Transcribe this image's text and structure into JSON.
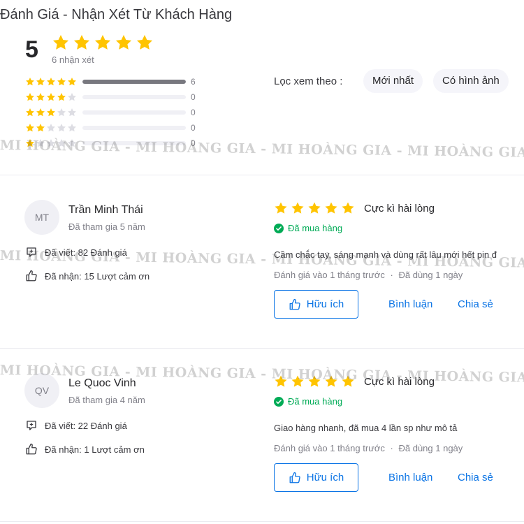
{
  "header": {
    "title": "Đánh Giá - Nhận Xét Từ Khách Hàng"
  },
  "summary": {
    "average": "5",
    "rating": 5,
    "count_label": "6 nhận xét"
  },
  "histogram": [
    {
      "stars": 5,
      "count": "6",
      "fraction": 1.0
    },
    {
      "stars": 4,
      "count": "0",
      "fraction": 0
    },
    {
      "stars": 3,
      "count": "0",
      "fraction": 0
    },
    {
      "stars": 2,
      "count": "0",
      "fraction": 0
    },
    {
      "stars": 1,
      "count": "0",
      "fraction": 0
    }
  ],
  "filter": {
    "label": "Lọc xem theo :",
    "options": [
      "Mới nhất",
      "Có hình ảnh"
    ]
  },
  "reviews": [
    {
      "initials": "MT",
      "name": "Trần Minh Thái",
      "joined": "Đã tham gia 5 năm",
      "written": "Đã viết: 82 Đánh giá",
      "thanks": "Đã nhận: 15 Lượt cảm ơn",
      "rating": 5,
      "headline": "Cực kì hài lòng",
      "verified": "Đã mua hàng",
      "content": "Cầm chắc tay, sáng mạnh và dùng rất lâu mới hết pin đ",
      "reviewed_time": "Đánh giá vào 1 tháng trước",
      "used_time": "Đã dùng 1 ngày"
    },
    {
      "initials": "QV",
      "name": "Le Quoc Vinh",
      "joined": "Đã tham gia 4 năm",
      "written": "Đã viết: 22 Đánh giá",
      "thanks": "Đã nhận: 1 Lượt cảm ơn",
      "rating": 5,
      "headline": "Cực kì hài lòng",
      "verified": "Đã mua hàng",
      "content": "Giao hàng nhanh, đã mua 4 lần sp như mô tả",
      "reviewed_time": "Đánh giá vào 1 tháng trước",
      "used_time": "Đã dùng 1 ngày"
    }
  ],
  "actions": {
    "helpful": "Hữu ích",
    "comment": "Bình luận",
    "share": "Chia sẻ"
  },
  "meta_separator": "·",
  "watermark": "MI HOÀNG GIA - MI HOÀNG GIA - MI HOÀNG GIA - MI HOÀNG GIA - MI HOÀNG GIA",
  "colors": {
    "star": "#ffc400",
    "star_empty": "#dddde3",
    "link": "#0b74e5",
    "verified": "#00ab56"
  },
  "icons": [
    "star-icon",
    "check-circle-icon",
    "comment-icon",
    "thumbs-up-icon"
  ]
}
